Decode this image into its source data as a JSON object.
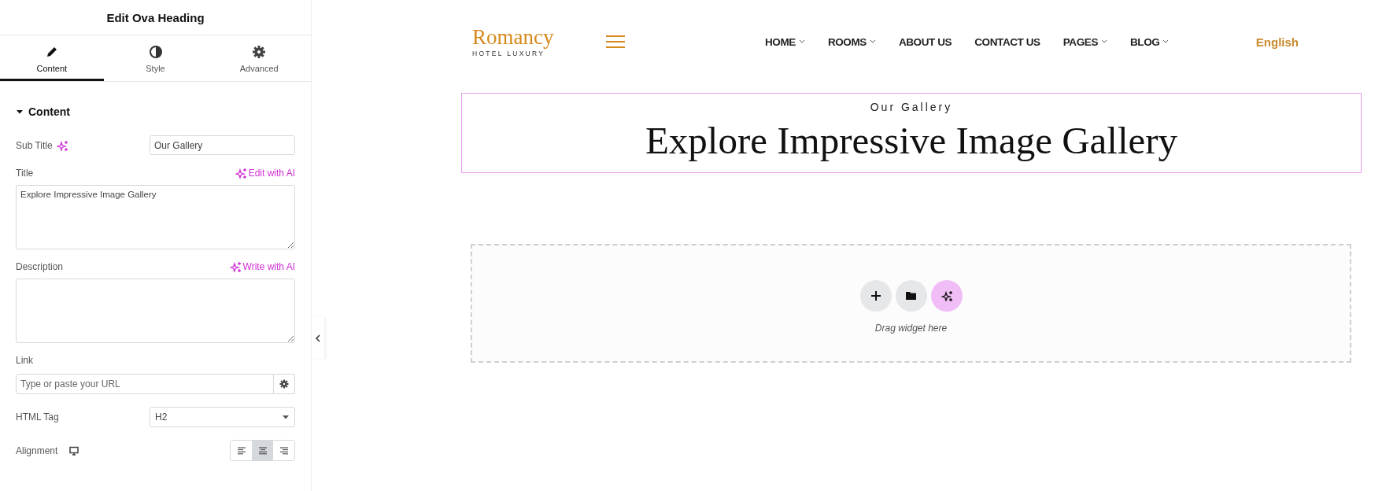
{
  "panel": {
    "title": "Edit Ova Heading",
    "tabs": [
      {
        "label": "Content",
        "selected": true
      },
      {
        "label": "Style",
        "selected": false
      },
      {
        "label": "Advanced",
        "selected": false
      }
    ],
    "section": {
      "title": "Content",
      "expanded": true
    },
    "fields": [
      {
        "kind": "text",
        "label": "Sub Title",
        "ai_icon": true,
        "value": "Our Gallery"
      },
      {
        "kind": "textarea",
        "label": "Title",
        "ai_link": "Edit with AI",
        "value": "Explore Impressive Image Gallery"
      },
      {
        "kind": "textarea",
        "label": "Description",
        "ai_link": "Write with AI"
      },
      {
        "kind": "url",
        "label": "Link",
        "placeholder": "Type or paste your URL"
      },
      {
        "kind": "select",
        "label": "HTML Tag",
        "value": "H2"
      },
      {
        "kind": "alignment",
        "label": "Alignment",
        "options": [
          {
            "selected": false
          },
          {
            "selected": true
          },
          {
            "selected": false
          }
        ]
      }
    ]
  },
  "site": {
    "logo": {
      "name": "Romancy",
      "tagline": "HOTEL LUXURY"
    },
    "nav": [
      {
        "label": "HOME",
        "dropdown": true
      },
      {
        "label": "ROOMS",
        "dropdown": true
      },
      {
        "label": "ABOUT US",
        "dropdown": false
      },
      {
        "label": "CONTACT US",
        "dropdown": false
      },
      {
        "label": "PAGES",
        "dropdown": true
      },
      {
        "label": "BLOG",
        "dropdown": true
      }
    ],
    "language": "English",
    "heading": {
      "subtitle": "Our Gallery",
      "title": "Explore Impressive Image Gallery"
    },
    "dropzone": {
      "hint": "Drag widget here"
    }
  }
}
